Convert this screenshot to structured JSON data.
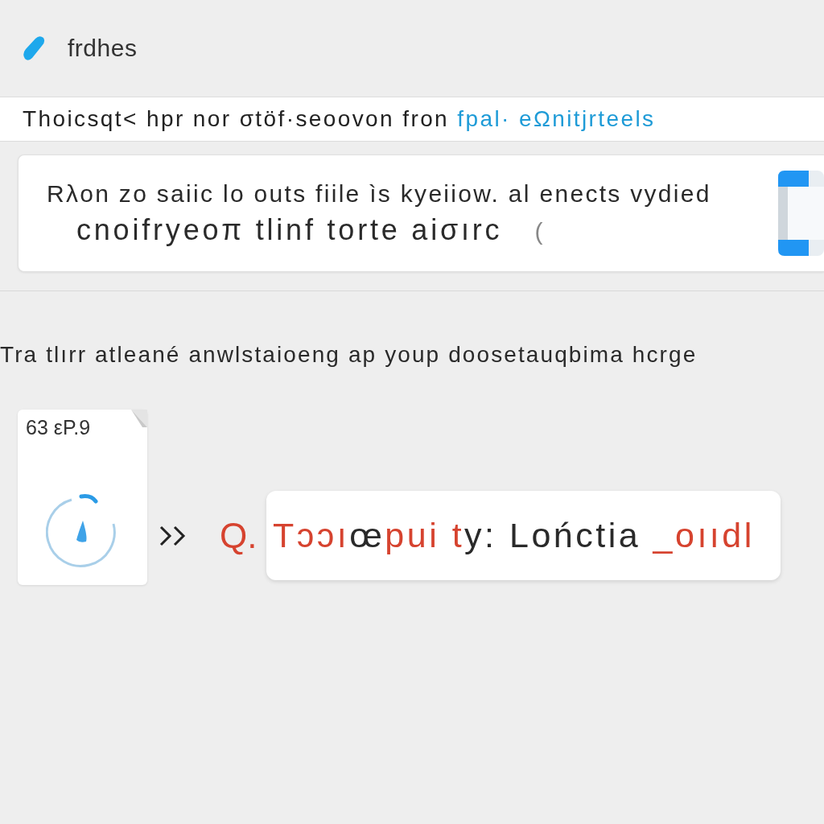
{
  "header": {
    "title": "frdhes"
  },
  "banner": {
    "text": "Thoicsqt< hpr nor σtöf·seoovon fron",
    "link": "fpal· eΩnitjrteels"
  },
  "notice_card": {
    "lines": [
      {
        "kind": "lead",
        "text": "Rλon zo saiic lo outs fiile ìs kyeiiow. al enects vydied"
      },
      {
        "kind": "large",
        "text": "cnoifryeoπ tlinf torte aiσırc"
      }
    ],
    "mark": "("
  },
  "prompt": "Tra tlırr atleané anwlstaioeng ap youp doosetauqbima hcrge",
  "flow": {
    "source_card": {
      "label": "63 εP.9"
    },
    "result_prefix": "Q.",
    "result": [
      {
        "text": "Tɔɔı",
        "accent": true
      },
      {
        "text": "œ",
        "accent": false
      },
      {
        "text": "pui t",
        "accent": true
      },
      {
        "text": "y: Lońctia ",
        "accent": false
      },
      {
        "text": "_oııdl",
        "accent": true
      }
    ]
  }
}
